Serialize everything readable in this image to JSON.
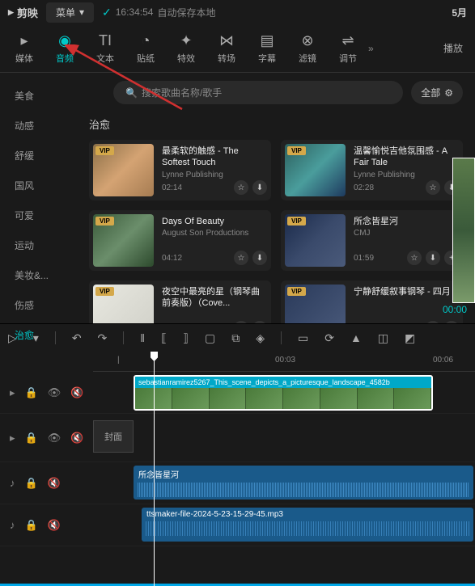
{
  "titleBar": {
    "logo": "剪映",
    "menu": "菜单",
    "statusTime": "16:34:54",
    "statusText": "自动保存本地",
    "date": "5月"
  },
  "toolbar": {
    "items": [
      "媒体",
      "音频",
      "文本",
      "贴纸",
      "特效",
      "转场",
      "字幕",
      "滤镜",
      "调节"
    ],
    "preview": "播放"
  },
  "sidebar": {
    "items": [
      "美食",
      "动感",
      "舒缓",
      "国风",
      "可爱",
      "运动",
      "美妆&...",
      "伤感",
      "治愈"
    ],
    "activeIndex": 8
  },
  "search": {
    "placeholder": "搜索歌曲名称/歌手",
    "filterLabel": "全部"
  },
  "sectionTitle": "治愈",
  "musicCards": [
    {
      "title": "最柔软的触感 - The Softest Touch",
      "artist": "Lynne Publishing",
      "duration": "02:14",
      "thumb": "t1"
    },
    {
      "title": "温馨愉悦吉他氛围感 - A Fair Tale",
      "artist": "Lynne Publishing",
      "duration": "02:28",
      "thumb": "t2"
    },
    {
      "title": "Days Of Beauty",
      "artist": "August Son Productions",
      "duration": "04:12",
      "thumb": "t3"
    },
    {
      "title": "所念皆星河",
      "artist": "CMJ",
      "duration": "01:59",
      "thumb": "t4"
    },
    {
      "title": "夜空中最亮的星（钢琴曲前奏版）（Cove...",
      "artist": "",
      "duration": "",
      "thumb": "t5"
    },
    {
      "title": "宁静舒缓叙事钢琴 - 四月",
      "artist": "",
      "duration": "",
      "thumb": "t6"
    }
  ],
  "timecode": "00:00",
  "timeline": {
    "ticks": [
      "00:03",
      "00:06"
    ],
    "videoClip": "sebastianramirez5267_This_scene_depicts_a_picturesque_landscape_4582b",
    "coverLabel": "封面",
    "audioClip1": "所念皆星河",
    "audioClip2": "ttsmaker-file-2024-5-23-15-29-45.mp3"
  }
}
